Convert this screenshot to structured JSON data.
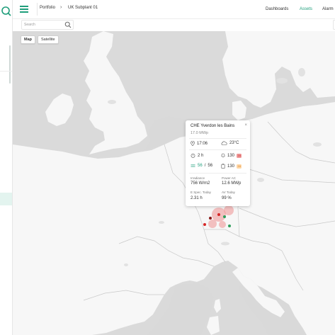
{
  "colors": {
    "accent": "#1f9e7b",
    "map_land": "#f7f7f7",
    "map_water": "#d9d9d9"
  },
  "breadcrumb": {
    "portfolio": "Portfolio",
    "separator_icon": "chevron-right-icon",
    "current": "UK Subplant 01"
  },
  "nav": {
    "dashboards": "Dashboards",
    "assets": "Assets",
    "alarms": "Alarm"
  },
  "search": {
    "placeholder": "Search"
  },
  "map": {
    "type_toggle": {
      "map": "Map",
      "satellite": "Satellite",
      "selected": "Map"
    },
    "markers": [
      {
        "status": "alarm",
        "color": "#d62828"
      },
      {
        "status": "alarm",
        "color": "#d62828"
      },
      {
        "status": "ok",
        "color": "#2e9e5b"
      },
      {
        "status": "alarm",
        "color": "#d62828"
      }
    ]
  },
  "popup": {
    "title": "CHE Yverdon les Bains",
    "close": "×",
    "capacity": "17.0 MWp",
    "time": "17:06",
    "temperature": "23°C",
    "duration": "2 h",
    "alarms_count": "130",
    "alarms_badge": "16",
    "inverters_ok": "56",
    "inverters_sep": "/",
    "inverters_total": "56",
    "tickets_count": "130",
    "tickets_badge": "16",
    "irradiance_label": "Irradiance",
    "irradiance_value": "756 W/m2",
    "power_label": "Power AC",
    "power_value": "12.6 MWp",
    "yield_label": "E Spec. Today",
    "yield_value": "2.31 h",
    "av_label": "AV Today",
    "av_value": "99 %"
  }
}
